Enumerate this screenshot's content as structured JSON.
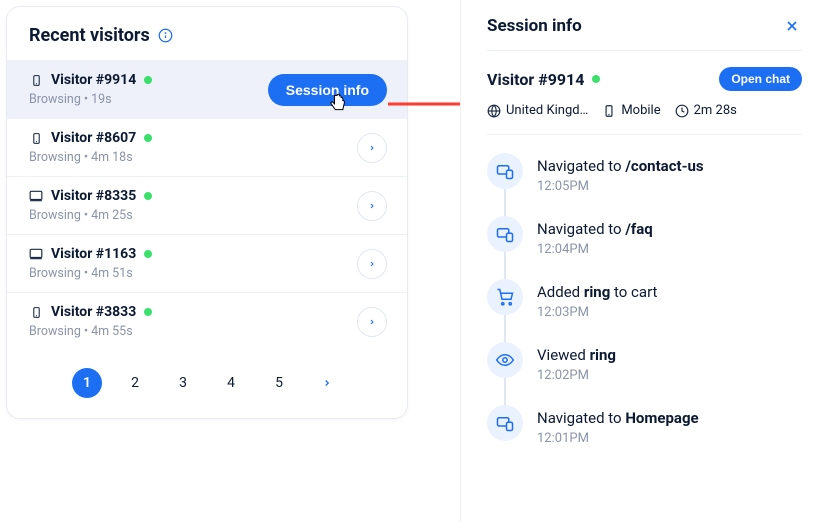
{
  "left": {
    "title": "Recent visitors",
    "visitors": [
      {
        "id": "Visitor #9914",
        "status": "Browsing",
        "duration": "19s",
        "device": "mobile",
        "active": true
      },
      {
        "id": "Visitor #8607",
        "status": "Browsing",
        "duration": "4m 18s",
        "device": "mobile",
        "active": false
      },
      {
        "id": "Visitor #8335",
        "status": "Browsing",
        "duration": "4m 25s",
        "device": "desktop",
        "active": false
      },
      {
        "id": "Visitor #1163",
        "status": "Browsing",
        "duration": "4m 51s",
        "device": "desktop",
        "active": false
      },
      {
        "id": "Visitor #3833",
        "status": "Browsing",
        "duration": "4m 55s",
        "device": "mobile",
        "active": false
      }
    ],
    "session_button_label": "Session info",
    "pages": [
      "1",
      "2",
      "3",
      "4",
      "5"
    ],
    "current_page": "1"
  },
  "right": {
    "title": "Session info",
    "visitor_name": "Visitor #9914",
    "open_chat_label": "Open chat",
    "meta": {
      "location": "United Kingd…",
      "device": "Mobile",
      "duration": "2m 28s"
    },
    "events": [
      {
        "icon": "nav",
        "prefix": "Navigated to ",
        "bold": "/contact-us",
        "suffix": "",
        "time": "12:05PM"
      },
      {
        "icon": "nav",
        "prefix": "Navigated to ",
        "bold": "/faq",
        "suffix": "",
        "time": "12:04PM"
      },
      {
        "icon": "cart",
        "prefix": "Added ",
        "bold": "ring",
        "suffix": " to cart",
        "time": "12:03PM"
      },
      {
        "icon": "eye",
        "prefix": "Viewed ",
        "bold": "ring",
        "suffix": "",
        "time": "12:02PM"
      },
      {
        "icon": "nav",
        "prefix": "Navigated to ",
        "bold": "Homepage",
        "suffix": "",
        "time": "12:01PM"
      }
    ]
  }
}
